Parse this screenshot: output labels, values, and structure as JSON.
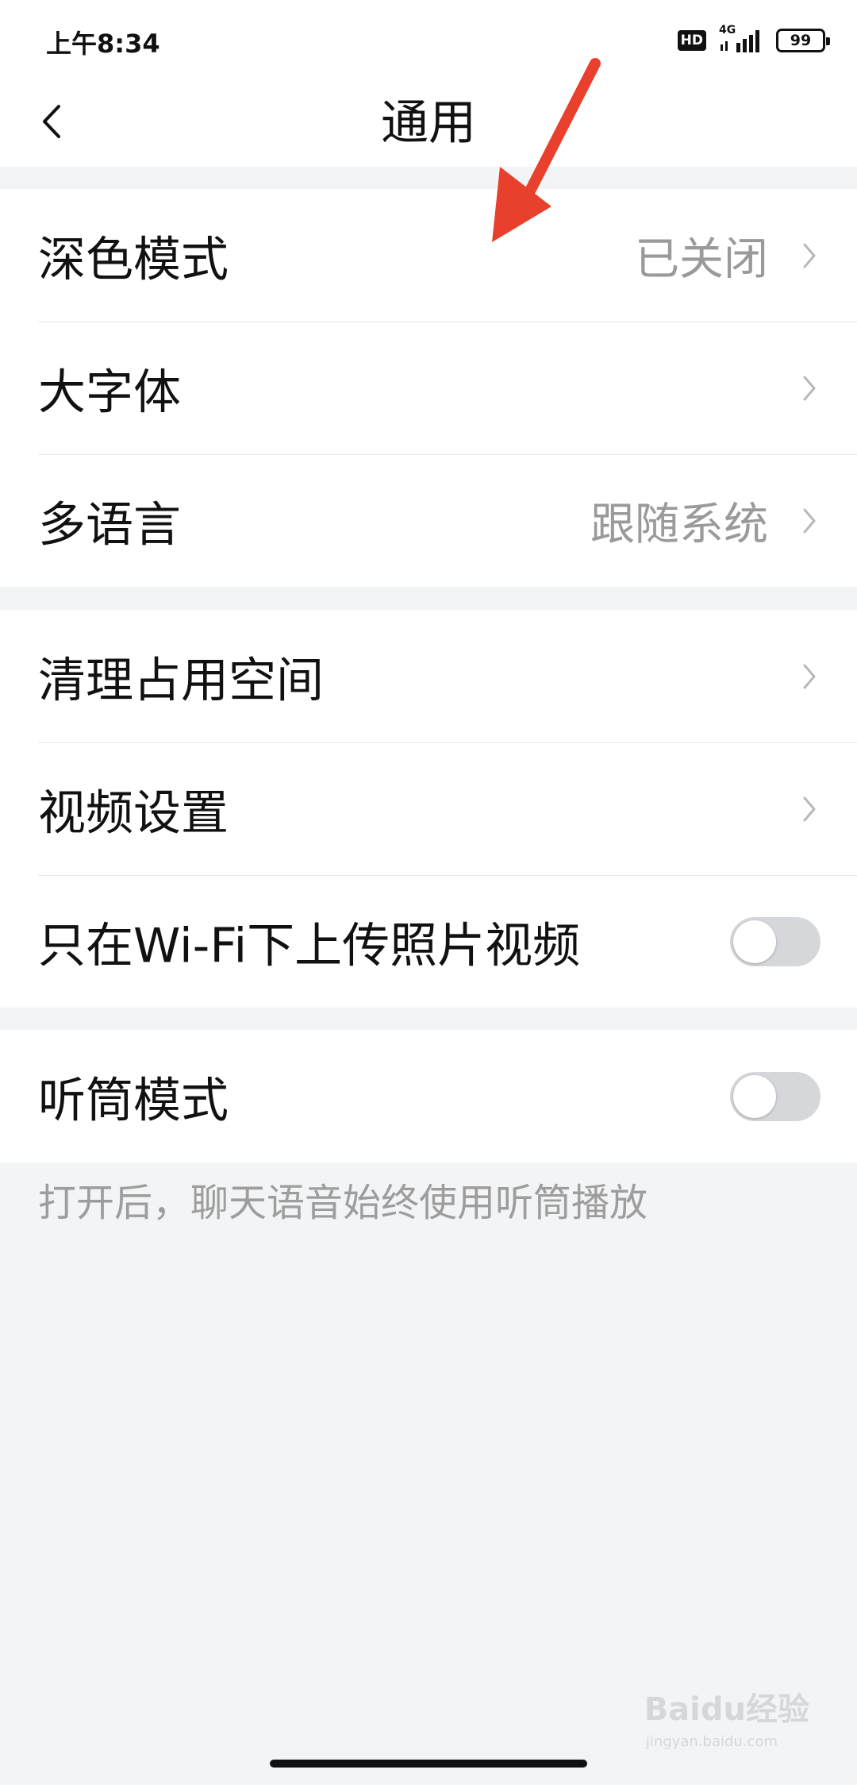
{
  "status_bar": {
    "time": "上午8:34",
    "hd_label": "HD",
    "network_label": "4G",
    "battery_level": "99"
  },
  "header": {
    "title": "通用",
    "back_icon": "chevron-left-icon"
  },
  "groups": [
    {
      "items": [
        {
          "label": "深色模式",
          "value": "已关闭",
          "control": "chevron"
        },
        {
          "label": "大字体",
          "value": "",
          "control": "chevron"
        },
        {
          "label": "多语言",
          "value": "跟随系统",
          "control": "chevron"
        }
      ]
    },
    {
      "items": [
        {
          "label": "清理占用空间",
          "value": "",
          "control": "chevron"
        },
        {
          "label": "视频设置",
          "value": "",
          "control": "chevron"
        },
        {
          "label": "只在Wi-Fi下上传照片视频",
          "control": "toggle",
          "toggle_on": false
        }
      ]
    },
    {
      "items": [
        {
          "label": "听筒模式",
          "control": "toggle",
          "toggle_on": false
        }
      ]
    }
  ],
  "footnote": "打开后，聊天语音始终使用听筒播放",
  "watermark": {
    "main": "Baidu经验",
    "sub": "jingyan.baidu.com"
  },
  "colors": {
    "background": "#f2f4f6",
    "annotation_arrow": "#e8402d",
    "toggle_off": "#d5d7da"
  }
}
